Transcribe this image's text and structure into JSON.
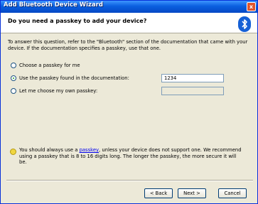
{
  "window": {
    "title": "Add Bluetooth Device Wizard",
    "close_glyph": "x"
  },
  "header": {
    "heading": "Do you need a passkey to add your device?"
  },
  "intro": "To answer this question, refer to the \"Bluetooth\" section of the documentation that came with your device. If the documentation specifies a passkey, use that one.",
  "options": [
    {
      "label": "Choose a passkey for me",
      "selected": false
    },
    {
      "label": "Use the passkey found in the documentation:",
      "selected": true
    },
    {
      "label": "Let me choose my own passkey:",
      "selected": false
    }
  ],
  "passkey_value": "1234",
  "custom_passkey_value": "",
  "tip": {
    "before": "You should always use a ",
    "link": "passkey",
    "after": ", unless your device does not support one. We recommend using a passkey that is 8 to 16 digits long. The longer the passkey, the more secure it will be."
  },
  "buttons": {
    "back": "< Back",
    "next": "Next >",
    "cancel": "Cancel"
  },
  "colors": {
    "titlebar": "#0a5fdf",
    "accent": "#1560d6"
  }
}
